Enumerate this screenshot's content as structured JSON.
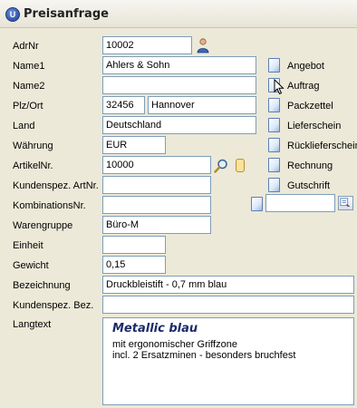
{
  "window": {
    "title": "Preisanfrage"
  },
  "app_icon_letter": "U",
  "fields": {
    "adrnr": {
      "label": "AdrNr",
      "value": "10002"
    },
    "name1": {
      "label": "Name1",
      "value": "Ahlers & Sohn"
    },
    "name2": {
      "label": "Name2",
      "value": ""
    },
    "plz_ort": {
      "label": "Plz/Ort",
      "plz": "32456",
      "ort": "Hannover"
    },
    "land": {
      "label": "Land",
      "value": "Deutschland"
    },
    "waehrung": {
      "label": "Währung",
      "value": "EUR"
    },
    "artikelnr": {
      "label": "ArtikelNr.",
      "value": "10000"
    },
    "kundenspez_artnr": {
      "label": "Kundenspez. ArtNr.",
      "value": ""
    },
    "kombinationsnr": {
      "label": "KombinationsNr.",
      "value": ""
    },
    "warengruppe": {
      "label": "Warengruppe",
      "value": "Büro-M"
    },
    "einheit": {
      "label": "Einheit",
      "value": ""
    },
    "gewicht": {
      "label": "Gewicht",
      "value": "0,15"
    },
    "bezeichnung": {
      "label": "Bezeichnung",
      "value": "Druckbleistift - 0,7 mm  blau"
    },
    "kundenspez_bez": {
      "label": "Kundenspez. Bez.",
      "value": ""
    },
    "langtext": {
      "label": "Langtext",
      "heading": "Metallic blau",
      "lines": [
        "mit ergonomischer Griffzone",
        "incl. 2 Ersatzminen - besonders bruchfest"
      ]
    }
  },
  "side_links": [
    {
      "label": "Angebot",
      "icon": "document-icon"
    },
    {
      "label": "Auftrag",
      "icon": "document-icon"
    },
    {
      "label": "Packzettel",
      "icon": "document-icon"
    },
    {
      "label": "Lieferschein",
      "icon": "document-icon"
    },
    {
      "label": "Rücklieferschein",
      "icon": "document-icon"
    },
    {
      "label": "Rechnung",
      "icon": "document-icon"
    },
    {
      "label": "Gutschrift",
      "icon": "document-icon"
    }
  ],
  "extra_document_field": {
    "value": ""
  },
  "colors": {
    "heading_text": "#1c2b6a",
    "field_border": "#7f9db9",
    "window_bg": "#ece9d8"
  }
}
